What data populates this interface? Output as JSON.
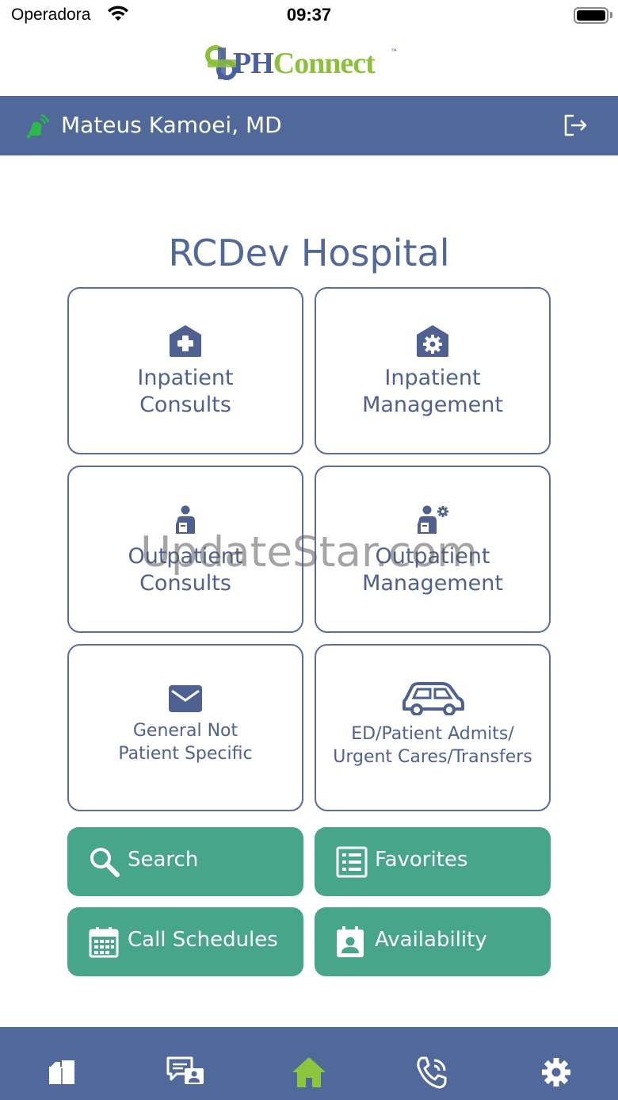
{
  "status_bar": {
    "carrier": "Operadora",
    "time": "09:37"
  },
  "logo": {
    "text_ph": "PH",
    "text_connect": "Connect",
    "tm": "™"
  },
  "header": {
    "user_name": "Mateus Kamoei, MD"
  },
  "hospital": {
    "name": "RCDev Hospital"
  },
  "tiles": [
    {
      "line1": "Inpatient",
      "line2": "Consults"
    },
    {
      "line1": "Inpatient",
      "line2": "Management"
    },
    {
      "line1": "Outpatient",
      "line2": "Consults"
    },
    {
      "line1": "Outpatient",
      "line2": "Management"
    },
    {
      "line1": "General Not",
      "line2": "Patient Specific"
    },
    {
      "line1": "ED/Patient Admits/",
      "line2": "Urgent Cares/Transfers"
    }
  ],
  "actions": [
    {
      "label": "Search",
      "icon": "search-icon"
    },
    {
      "label": "Favorites",
      "icon": "list-icon"
    },
    {
      "label": "Call Schedules",
      "icon": "calendar-icon"
    },
    {
      "label": "Availability",
      "icon": "contact-card-icon"
    }
  ],
  "watermark": "UpdateStar.com",
  "tab_bar": {
    "tabs": [
      "documents-icon",
      "chat-user-icon",
      "home-icon",
      "phone-call-icon",
      "gear-icon"
    ],
    "active_index": 2
  },
  "colors": {
    "header_blue": "#51689a",
    "action_green": "#47a589",
    "active_tab": "#8cc63f",
    "logo_green": "#8cbf3a"
  }
}
